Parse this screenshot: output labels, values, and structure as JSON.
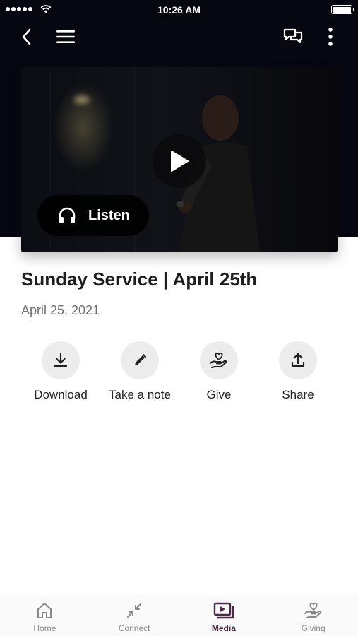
{
  "status_bar": {
    "time": "10:26 AM"
  },
  "nav": {
    "back_icon": "chevron-left-icon",
    "menu_icon": "hamburger-icon",
    "chat_icon": "chat-bubbles-icon",
    "more_icon": "vertical-ellipsis-icon"
  },
  "media": {
    "listen_label": "Listen",
    "title": "Sunday Service | April 25th",
    "date": "April 25, 2021"
  },
  "actions": [
    {
      "label": "Download",
      "icon": "download-icon"
    },
    {
      "label": "Take a note",
      "icon": "pencil-icon"
    },
    {
      "label": "Give",
      "icon": "hand-heart-icon"
    },
    {
      "label": "Share",
      "icon": "share-icon"
    }
  ],
  "tabs": [
    {
      "label": "Home",
      "icon": "home-icon",
      "active": false
    },
    {
      "label": "Connect",
      "icon": "connect-arrows-icon",
      "active": false
    },
    {
      "label": "Media",
      "icon": "media-play-icon",
      "active": true
    },
    {
      "label": "Giving",
      "icon": "hand-heart-icon",
      "active": false
    }
  ],
  "colors": {
    "header_bg": "#070712",
    "accent": "#4a2a46",
    "tab_inactive": "#8a8a8a",
    "action_circle": "#ececec"
  }
}
